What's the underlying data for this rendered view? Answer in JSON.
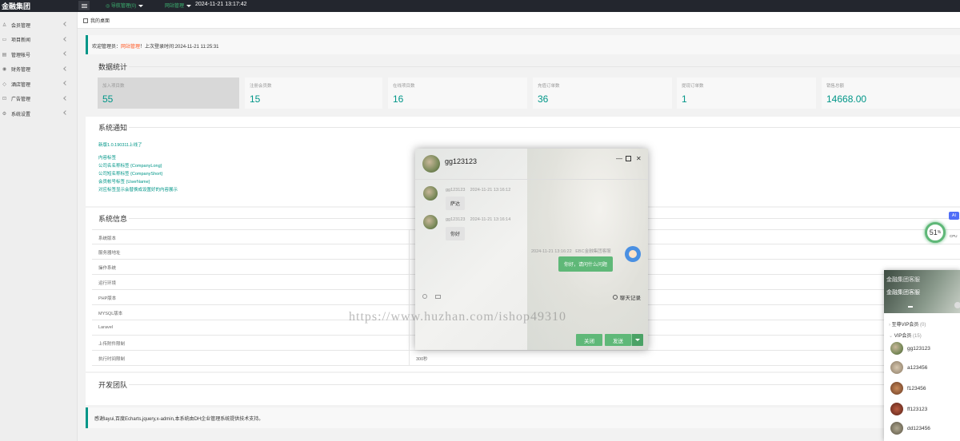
{
  "topbar": {
    "logo": "金融集团",
    "user_menu": "◎ 导航管理(0)",
    "site_menu": "网站管理",
    "time": "2024-11-21 13:17:42"
  },
  "sidebar": {
    "items": [
      {
        "label": "会员管理",
        "icon": "user-icon"
      },
      {
        "label": "项目新闻",
        "icon": "book-icon"
      },
      {
        "label": "管理帐号",
        "icon": "account-icon"
      },
      {
        "label": "财务管理",
        "icon": "money-icon"
      },
      {
        "label": "酒店管理",
        "icon": "hotel-icon"
      },
      {
        "label": "广告管理",
        "icon": "cart-icon"
      },
      {
        "label": "系统设置",
        "icon": "gear-icon"
      }
    ]
  },
  "tabs": {
    "home": "我的桌面"
  },
  "welcome": {
    "prefix": "欢迎管理员：",
    "admin": "网站管理",
    "suffix": "！上次登录时间:2024-11-21 11:25:31"
  },
  "stats": {
    "title": "数据统计",
    "items": [
      {
        "label": "加入项目数",
        "value": "55"
      },
      {
        "label": "注册会员数",
        "value": "15"
      },
      {
        "label": "在线项目数",
        "value": "16"
      },
      {
        "label": "充值订单数",
        "value": "36"
      },
      {
        "label": "提现订单数",
        "value": "1"
      },
      {
        "label": "销售总额",
        "value": "14668.00"
      }
    ]
  },
  "notice": {
    "title": "系统通知",
    "version": "新版1.0.190311上线了",
    "links": [
      "内容标签",
      "公司名名称标签 {CompanyLong}",
      "公司短名称标签 {CompanyShort}",
      "会员帐号标签 {UserName}",
      "对应标签显示会替换成设置好的内容展示"
    ]
  },
  "sysinfo": {
    "title": "系统信息",
    "rows": [
      {
        "key": "系统版本",
        "value": ""
      },
      {
        "key": "服务器地址",
        "value": ""
      },
      {
        "key": "操作系统",
        "value": ""
      },
      {
        "key": "运行环境",
        "value": ""
      },
      {
        "key": "PHP版本",
        "value": ""
      },
      {
        "key": "MYSQL版本",
        "value": ""
      },
      {
        "key": "Laravel",
        "value": ""
      },
      {
        "key": "上传附件限制",
        "value": ""
      },
      {
        "key": "执行时间限制",
        "value": "300秒"
      }
    ]
  },
  "team": {
    "title": "开发团队",
    "thanks": "感谢layui,百度Echarts,jquery,x-admin,本系统由DH企业管理系统提供技术支持。"
  },
  "chat": {
    "name": "gg123123",
    "messages": [
      {
        "from": "gg123123",
        "time": "2024-11-21 13:16:12",
        "text": "萨达"
      },
      {
        "from": "gg123123",
        "time": "2024-11-21 13:16:14",
        "text": "你好"
      }
    ],
    "my_message": {
      "time": "2024-11-21 13:16:22",
      "from": "EBC金融集团客服",
      "text": "你好，请问什么问题"
    },
    "history_label": "聊天记录",
    "close_label": "关闭",
    "send_label": "发送"
  },
  "watermark": "https://www.huzhan.com/ishop49310",
  "monitor": {
    "cpu_percent": "51",
    "unit": "%",
    "ai": "AI",
    "cpu_label": "CPU"
  },
  "customer_service": {
    "title": "金融集团客服",
    "subtitle": "金融集团客服",
    "groups": [
      {
        "name": "至尊VIP会员",
        "count": "(0)"
      },
      {
        "name": "VIP会员",
        "count": "(15)"
      }
    ],
    "users": [
      "gg123123",
      "a123456",
      "f123456",
      "ff123123",
      "dd123456"
    ]
  }
}
